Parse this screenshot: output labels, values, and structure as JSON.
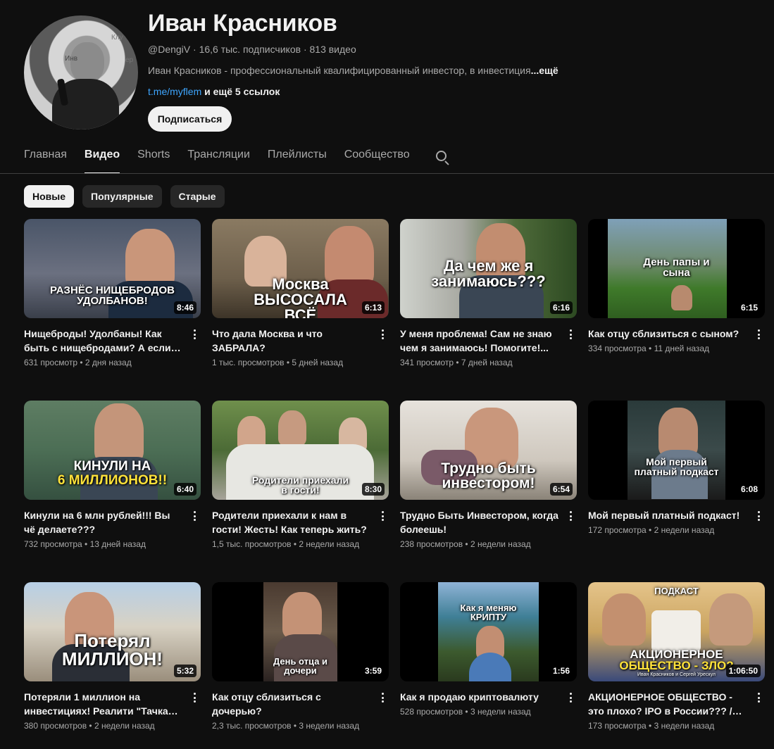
{
  "channel": {
    "name": "Иван Красников",
    "meta": "@DengiV · 16,6 тыс. подписчиков · 813 видео",
    "description": "Иван Красников - профессиональный квалифицированный инвестор, в инвестиция",
    "description_more": "...ещё",
    "link": "t.me/myflem",
    "more_links": " и ещё 5 ссылок",
    "subscribe_label": "Подписаться",
    "avatar_text_1": "Клу",
    "avatar_text_2": "Инв",
    "avatar_text_3": "ер"
  },
  "tabs": [
    {
      "label": "Главная"
    },
    {
      "label": "Видео",
      "active": true
    },
    {
      "label": "Shorts"
    },
    {
      "label": "Трансляции"
    },
    {
      "label": "Плейлисты"
    },
    {
      "label": "Сообщество"
    }
  ],
  "chips": [
    {
      "label": "Новые",
      "active": true
    },
    {
      "label": "Популярные"
    },
    {
      "label": "Старые"
    }
  ],
  "videos": [
    {
      "title": "Нищеброды! Удолбаны! Как быть с нищебродами? А если ты сам...",
      "meta": "631 просмотр • 2 дня назад",
      "duration": "8:46",
      "overlay": "РАЗНЁС НИЩЕБРОДОВ УДОЛБАНОВ!"
    },
    {
      "title": "Что дала Москва и что ЗАБРАЛА?",
      "meta": "1 тыс. просмотров • 5 дней назад",
      "duration": "6:13",
      "overlay": "Москва ВЫСОСАЛА ВСЁ"
    },
    {
      "title": "У меня проблема! Сам не знаю чем я занимаюсь! Помогите!...",
      "meta": "341 просмотр • 7 дней назад",
      "duration": "6:16",
      "overlay": "Да чем же я занимаюсь???"
    },
    {
      "title": "Как отцу сблизиться с сыном?",
      "meta": "334 просмотра • 11 дней назад",
      "duration": "6:15",
      "overlay": "День папы и сына"
    },
    {
      "title": "Кинули на 6 млн рублей!!! Вы чё делаете???",
      "meta": "732 просмотра • 13 дней назад",
      "duration": "6:40",
      "overlay": "КИНУЛИ НА",
      "overlay2": "6 МИЛЛИОНОВ!!"
    },
    {
      "title": "Родители приехали к нам в гости! Жесть! Как теперь жить?",
      "meta": "1,5 тыс. просмотров • 2 недели назад",
      "duration": "8:30",
      "overlay": "Родители приехали в гости!"
    },
    {
      "title": "Трудно Быть Инвестором, когда болеешь!",
      "meta": "238 просмотров • 2 недели назад",
      "duration": "6:54",
      "overlay": "Трудно быть инвестором!"
    },
    {
      "title": "Мой первый платный подкаст!",
      "meta": "172 просмотра • 2 недели назад",
      "duration": "6:08",
      "overlay": "Мой первый платный подкаст"
    },
    {
      "title": "Потеряли 1 миллион на инвестициях! Реалити \"Тачка на...",
      "meta": "380 просмотров • 2 недели назад",
      "duration": "5:32",
      "overlay": "Потерял МИЛЛИОН!"
    },
    {
      "title": "Как отцу сблизиться с дочерью?",
      "meta": "2,3 тыс. просмотров • 3 недели назад",
      "duration": "3:59",
      "overlay": "День отца и дочери"
    },
    {
      "title": "Как я продаю криптовалюту",
      "meta": "528 просмотров • 3 недели назад",
      "duration": "1:56",
      "overlay": "Как я меняю КРИПТУ"
    },
    {
      "title": "АКЦИОНЕРНОЕ ОБЩЕСТВО - это плохо? IPO в России??? / Подкас...",
      "meta": "173 просмотра • 3 недели назад",
      "duration": "1:06:50",
      "overlay_top": "ПОДКАСТ",
      "overlay": "АКЦИОНЕРНОЕ",
      "overlay2": "ОБЩЕСТВО - ЗЛО?",
      "overlay3": "Иван Красников и Сергей Урескул"
    }
  ],
  "colors": {
    "background": "#0f0f0f",
    "text": "#f1f1f1",
    "secondary_text": "#aaaaaa",
    "link": "#3ea6ff",
    "chip_bg": "#272727",
    "highlight_yellow": "#ffe23a"
  }
}
